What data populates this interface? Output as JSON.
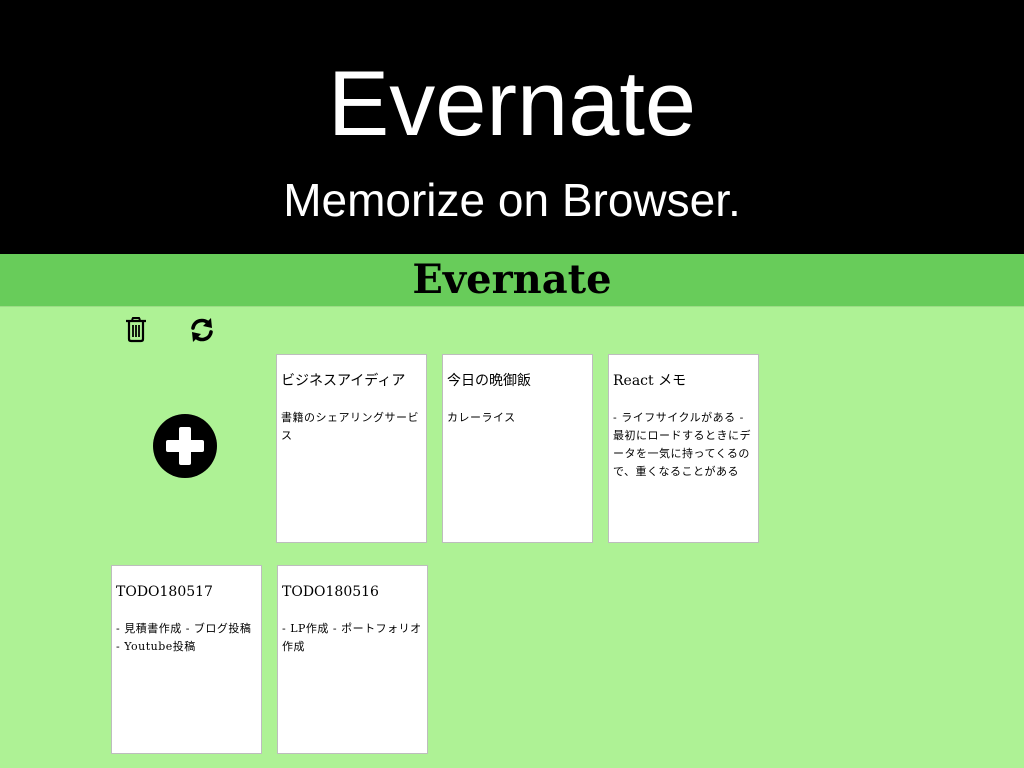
{
  "hero": {
    "title": "Evernate",
    "subtitle": "Memorize on Browser."
  },
  "app": {
    "title": "Evernate",
    "toolbar": {
      "delete_icon": "trash-icon",
      "refresh_icon": "refresh-icon",
      "add_icon": "plus-circle-icon"
    },
    "notes": [
      {
        "title": "ビジネスアイディア",
        "body": "書籍のシェアリングサービス"
      },
      {
        "title": "今日の晩御飯",
        "body": "カレーライス"
      },
      {
        "title": "React メモ",
        "body": "- ライフサイクルがある - 最初にロードするときにデータを一気に持ってくるので、重くなることがある"
      },
      {
        "title": "TODO180517",
        "body": "- 見積書作成 - ブログ投稿 - Youtube投稿"
      },
      {
        "title": "TODO180516",
        "body": "- LP作成 - ポートフォリオ作成"
      }
    ]
  },
  "colors": {
    "hero_background": "#000000",
    "app_background": "#aef295",
    "header_background": "#68cc5a",
    "card_background": "#ffffff"
  }
}
